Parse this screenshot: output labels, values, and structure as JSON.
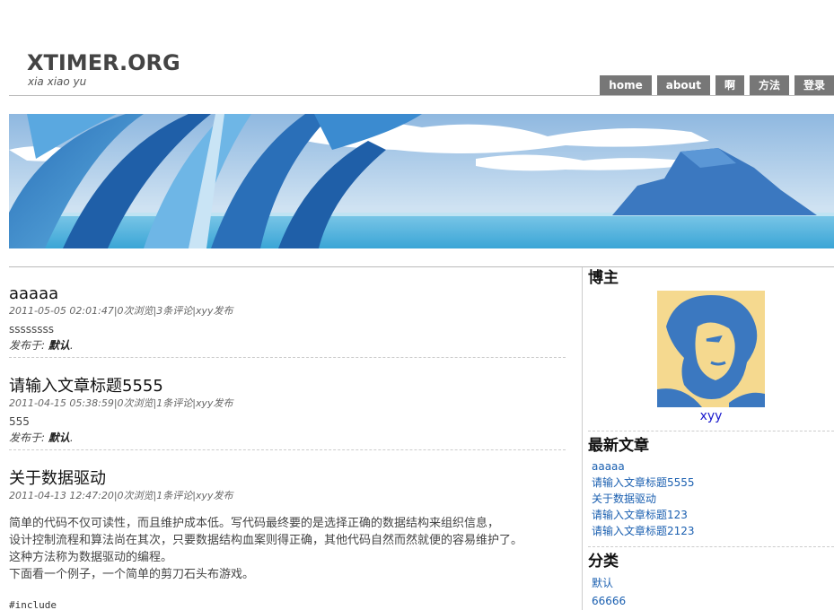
{
  "site": {
    "title": "XTIMER.ORG",
    "subtitle": "xia xiao yu"
  },
  "nav": [
    "home",
    "about",
    "啊",
    "方法",
    "登录"
  ],
  "posts": [
    {
      "title": "aaaaa",
      "meta": "2011-05-05 02:01:47|0次浏览|3条评论|xyy发布",
      "body": "ssssssss",
      "tag_prefix": "发布于: ",
      "tag": "默认",
      "tag_suffix": "."
    },
    {
      "title": "请输入文章标题5555",
      "meta": "2011-04-15 05:38:59|0次浏览|1条评论|xyy发布",
      "body": "555",
      "tag_prefix": "发布于: ",
      "tag": "默认",
      "tag_suffix": "."
    },
    {
      "title": "关于数据驱动",
      "meta": "2011-04-13 12:47:20|0次浏览|1条评论|xyy发布",
      "lines": [
        "简单的代码不仅可读性，而且维护成本低。写代码最终要的是选择正确的数据结构来组织信息，",
        "设计控制流程和算法尚在其次，只要数据结构血案则得正确，其他代码自然而然就便的容易维护了。",
        "这种方法称为数据驱动的编程。",
        "下面看一个例子，一个简单的剪刀石头布游戏。"
      ],
      "code": "#include"
    }
  ],
  "sidebar": {
    "author_title": "博主",
    "author_name": "xyy",
    "recent_title": "最新文章",
    "recent": [
      "aaaaa",
      "请输入文章标题5555",
      "关于数据驱动",
      "请输入文章标题123",
      "请输入文章标题2123"
    ],
    "cat_title": "分类",
    "categories": [
      "默认",
      "66666"
    ]
  },
  "colors": {
    "nav_bg": "#777777",
    "link": "#1a5fb0",
    "avatar_bg": "#f5d98f",
    "avatar_fg": "#3b78c0"
  }
}
